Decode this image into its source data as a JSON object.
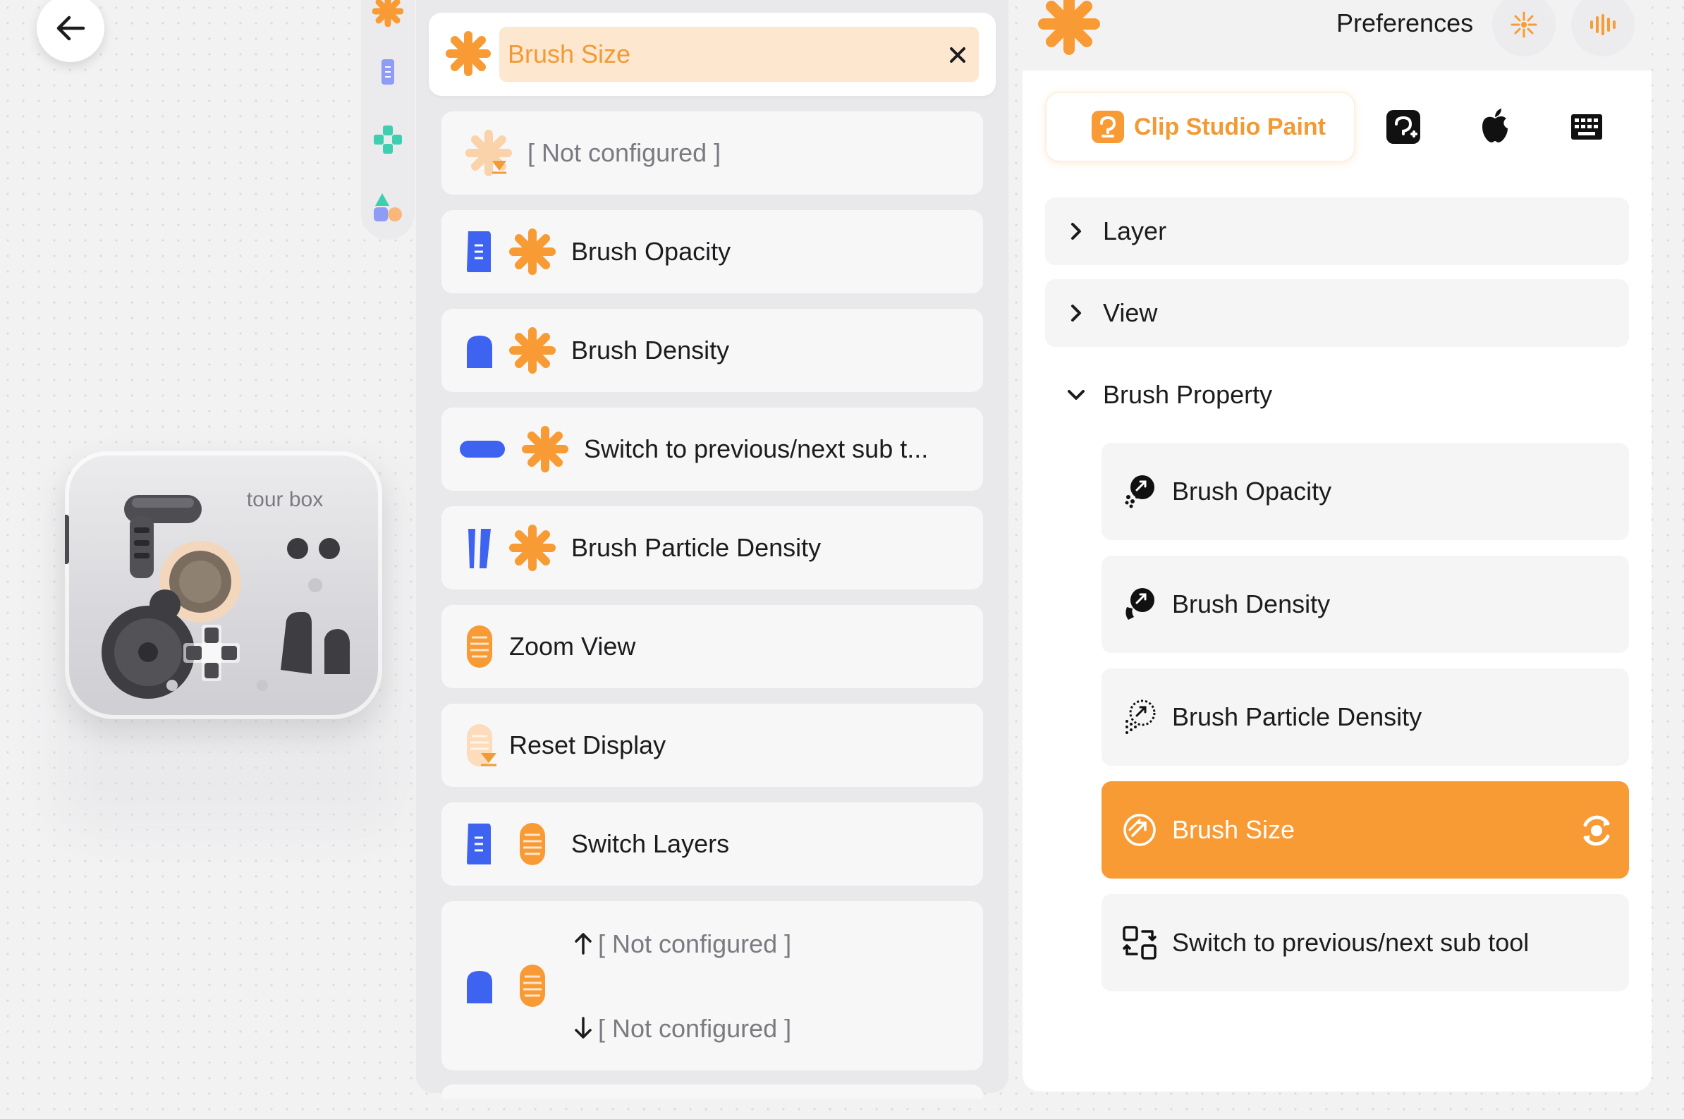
{
  "colors": {
    "accent": "#f99b34",
    "accent_soft": "#fde7cf",
    "blue": "#3e63f0",
    "teal": "#3ecfb0"
  },
  "header": {
    "title": "Brush Size",
    "close_icon": "close-icon"
  },
  "preferences": {
    "label": "Preferences"
  },
  "list": [
    {
      "label": "[ Not configured ]",
      "icons": [
        "dial-pending-icon"
      ],
      "grey": true
    },
    {
      "label": "Brush Opacity",
      "icons": [
        "tall-button-icon",
        "dial-icon"
      ]
    },
    {
      "label": "Brush Density",
      "icons": [
        "short-button-icon",
        "dial-icon"
      ]
    },
    {
      "label": "Switch to previous/next sub t...",
      "icons": [
        "long-button-icon",
        "dial-icon"
      ]
    },
    {
      "label": "Brush Particle Density",
      "icons": [
        "side-buttons-icon",
        "dial-icon"
      ]
    },
    {
      "label": "Zoom View",
      "icons": [
        "scroll-wheel-icon"
      ]
    },
    {
      "label": "Reset Display",
      "icons": [
        "scroll-wheel-pending-icon"
      ]
    },
    {
      "label": "Switch Layers",
      "icons": [
        "tall-button-icon",
        "scroll-wheel-icon"
      ]
    }
  ],
  "combo_row": {
    "up_label": "[ Not configured ]",
    "down_label": "[ Not configured ]"
  },
  "apps": {
    "active": "Clip Studio Paint"
  },
  "categories": [
    {
      "label": "Layer",
      "expanded": false
    },
    {
      "label": "View",
      "expanded": false
    },
    {
      "label": "Brush Property",
      "expanded": true
    }
  ],
  "brush_items": [
    {
      "label": "Brush Opacity",
      "active": false
    },
    {
      "label": "Brush Density",
      "active": false
    },
    {
      "label": "Brush Particle Density",
      "active": false
    },
    {
      "label": "Brush Size",
      "active": true
    },
    {
      "label": "Switch to previous/next sub tool",
      "active": false
    }
  ],
  "device": {
    "logo": "tour box"
  }
}
